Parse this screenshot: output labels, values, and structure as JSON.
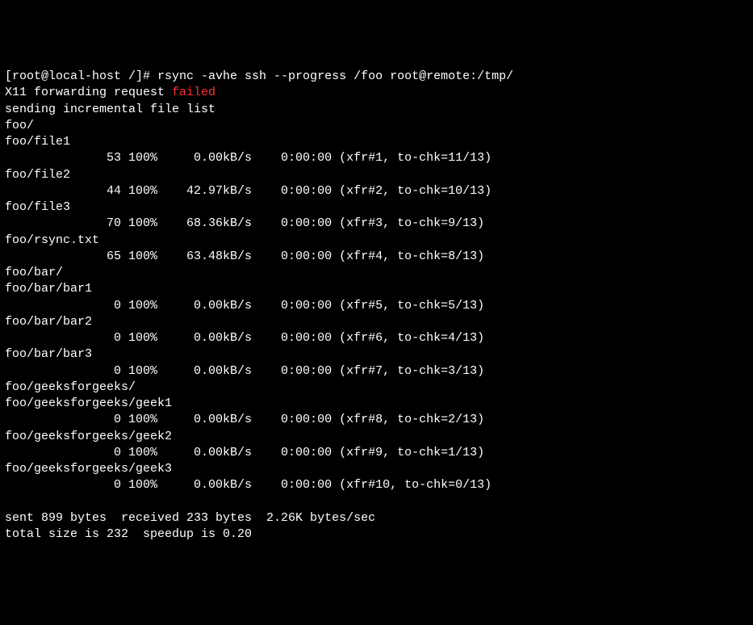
{
  "prompt": "[root@local-host /]# ",
  "command": "rsync -avhe ssh --progress /foo root@remote:/tmp/",
  "x11_prefix": "X11 forwarding request ",
  "x11_failed": "failed",
  "sending": "sending incremental file list",
  "entries": [
    {
      "name": "foo/"
    },
    {
      "name": "foo/file1",
      "size": "53",
      "pct": "100%",
      "rate": "0.00kB/s",
      "time": "0:00:00",
      "xfr": "(xfr#1, to-chk=11/13)"
    },
    {
      "name": "foo/file2",
      "size": "44",
      "pct": "100%",
      "rate": "42.97kB/s",
      "time": "0:00:00",
      "xfr": "(xfr#2, to-chk=10/13)"
    },
    {
      "name": "foo/file3",
      "size": "70",
      "pct": "100%",
      "rate": "68.36kB/s",
      "time": "0:00:00",
      "xfr": "(xfr#3, to-chk=9/13)"
    },
    {
      "name": "foo/rsync.txt",
      "size": "65",
      "pct": "100%",
      "rate": "63.48kB/s",
      "time": "0:00:00",
      "xfr": "(xfr#4, to-chk=8/13)"
    },
    {
      "name": "foo/bar/"
    },
    {
      "name": "foo/bar/bar1",
      "size": "0",
      "pct": "100%",
      "rate": "0.00kB/s",
      "time": "0:00:00",
      "xfr": "(xfr#5, to-chk=5/13)"
    },
    {
      "name": "foo/bar/bar2",
      "size": "0",
      "pct": "100%",
      "rate": "0.00kB/s",
      "time": "0:00:00",
      "xfr": "(xfr#6, to-chk=4/13)"
    },
    {
      "name": "foo/bar/bar3",
      "size": "0",
      "pct": "100%",
      "rate": "0.00kB/s",
      "time": "0:00:00",
      "xfr": "(xfr#7, to-chk=3/13)"
    },
    {
      "name": "foo/geeksforgeeks/"
    },
    {
      "name": "foo/geeksforgeeks/geek1",
      "size": "0",
      "pct": "100%",
      "rate": "0.00kB/s",
      "time": "0:00:00",
      "xfr": "(xfr#8, to-chk=2/13)"
    },
    {
      "name": "foo/geeksforgeeks/geek2",
      "size": "0",
      "pct": "100%",
      "rate": "0.00kB/s",
      "time": "0:00:00",
      "xfr": "(xfr#9, to-chk=1/13)"
    },
    {
      "name": "foo/geeksforgeeks/geek3",
      "size": "0",
      "pct": "100%",
      "rate": "0.00kB/s",
      "time": "0:00:00",
      "xfr": "(xfr#10, to-chk=0/13)"
    }
  ],
  "summary1": "sent 899 bytes  received 233 bytes  2.26K bytes/sec",
  "summary2": "total size is 232  speedup is 0.20"
}
